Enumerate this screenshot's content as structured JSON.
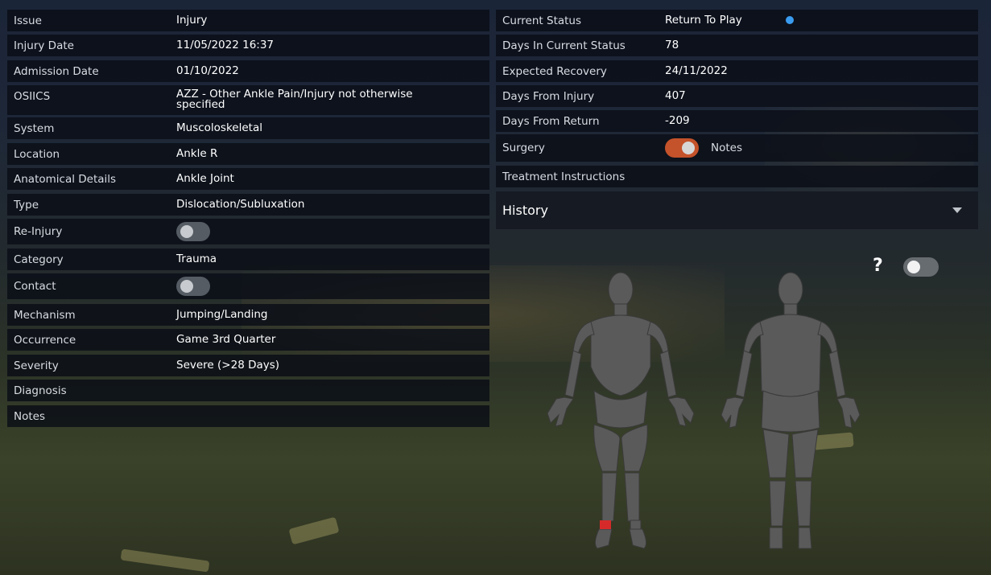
{
  "left_table": [
    {
      "label": "Issue",
      "value": "Injury"
    },
    {
      "label": "Injury Date",
      "value": "11/05/2022 16:37"
    },
    {
      "label": "Admission Date",
      "value": "01/10/2022"
    },
    {
      "label": "OSIICS",
      "value": "AZZ - Other Ankle Pain/Injury not otherwise specified"
    },
    {
      "label": "System",
      "value": "Muscoloskeletal"
    },
    {
      "label": "Location",
      "value": "Ankle R"
    },
    {
      "label": "Anatomical Details",
      "value": "Ankle Joint"
    },
    {
      "label": "Type",
      "value": "Dislocation/Subluxation"
    },
    {
      "label": "Re-Injury",
      "toggle": false
    },
    {
      "label": "Category",
      "value": "Trauma"
    },
    {
      "label": "Contact",
      "toggle": false
    },
    {
      "label": "Mechanism",
      "value": "Jumping/Landing"
    },
    {
      "label": "Occurrence",
      "value": "Game 3rd Quarter"
    },
    {
      "label": "Severity",
      "value": "Severe (>28 Days)"
    },
    {
      "label": "Diagnosis",
      "value": ""
    },
    {
      "label": "Notes",
      "value": ""
    }
  ],
  "right_table": {
    "current_status": {
      "label": "Current Status",
      "value": "Return To Play",
      "dot_color": "#3a9cf0"
    },
    "days_in_status": {
      "label": "Days In Current Status",
      "value": "78"
    },
    "expected_recovery": {
      "label": "Expected Recovery",
      "value": "24/11/2022"
    },
    "days_from_injury": {
      "label": "Days From Injury",
      "value": "407"
    },
    "days_from_return": {
      "label": "Days From Return",
      "value": "-209"
    },
    "surgery": {
      "label": "Surgery",
      "toggle": true,
      "notes_label": "Notes"
    },
    "treatment": {
      "label": "Treatment Instructions",
      "value": ""
    }
  },
  "history": {
    "title": "History"
  },
  "body_map": {
    "help_label": "?",
    "toggle": false,
    "injury_marker_color": "#d62a2a"
  },
  "colors": {
    "toggle_on": "#c4522a",
    "toggle_off": "#555c63"
  }
}
